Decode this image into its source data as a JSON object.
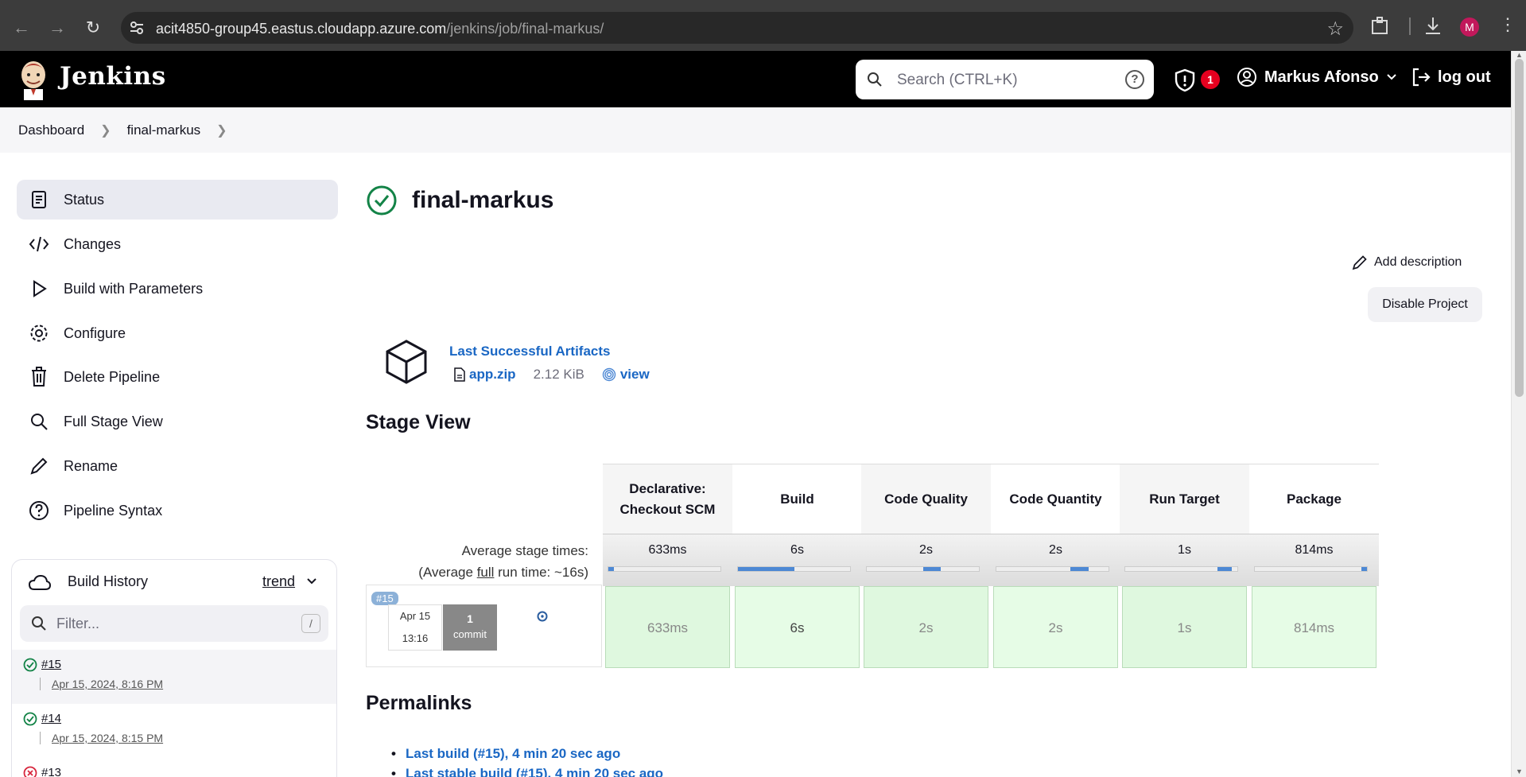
{
  "browser": {
    "url_host": "acit4850-group45.eastus.cloudapp.azure.com",
    "url_path": "/jenkins/job/final-markus/",
    "profile_initial": "M"
  },
  "header": {
    "brand": "Jenkins",
    "search_placeholder": "Search (CTRL+K)",
    "security_count": "1",
    "user_name": "Markus Afonso",
    "logout_label": "log out"
  },
  "breadcrumb": [
    "Dashboard",
    "final-markus"
  ],
  "sidebar": {
    "items": [
      {
        "label": "Status",
        "icon": "status-icon"
      },
      {
        "label": "Changes",
        "icon": "code-icon"
      },
      {
        "label": "Build with Parameters",
        "icon": "play-icon"
      },
      {
        "label": "Configure",
        "icon": "gear-icon"
      },
      {
        "label": "Delete Pipeline",
        "icon": "trash-icon"
      },
      {
        "label": "Full Stage View",
        "icon": "search-icon"
      },
      {
        "label": "Rename",
        "icon": "pencil-icon"
      },
      {
        "label": "Pipeline Syntax",
        "icon": "help-icon"
      }
    ]
  },
  "build_history": {
    "title": "Build History",
    "trend_label": "trend",
    "filter_placeholder": "Filter...",
    "filter_shortcut": "/",
    "builds": [
      {
        "number": "#15",
        "date": "Apr 15, 2024, 8:16 PM",
        "status": "success"
      },
      {
        "number": "#14",
        "date": "Apr 15, 2024, 8:15 PM",
        "status": "success"
      },
      {
        "number": "#13",
        "date": "",
        "status": "failed"
      }
    ]
  },
  "main": {
    "title": "final-markus",
    "add_description": "Add description",
    "disable_project": "Disable Project",
    "last_successful_artifacts": "Last Successful Artifacts",
    "artifact_name": "app.zip",
    "artifact_size": "2.12 KiB",
    "artifact_view": "view",
    "stage_view_title": "Stage View",
    "avg_stage_times_label": "Average stage times:",
    "avg_full_prefix": "(Average ",
    "avg_full_word": "full",
    "avg_full_suffix": " run time: ~16s)",
    "stages": [
      {
        "name": "Declarative: Checkout SCM",
        "avg": "633ms",
        "run": "633ms",
        "bar": [
          0.0,
          0.05
        ]
      },
      {
        "name": "Build",
        "avg": "6s",
        "run": "6s",
        "bar": [
          0.0,
          0.5
        ]
      },
      {
        "name": "Code Quality",
        "avg": "2s",
        "run": "2s",
        "bar": [
          0.5,
          0.66
        ]
      },
      {
        "name": "Code Quantity",
        "avg": "2s",
        "run": "2s",
        "bar": [
          0.66,
          0.82
        ]
      },
      {
        "name": "Run Target",
        "avg": "1s",
        "run": "1s",
        "bar": [
          0.82,
          0.95
        ]
      },
      {
        "name": "Package",
        "avg": "814ms",
        "run": "814ms",
        "bar": [
          0.95,
          1.0
        ]
      }
    ],
    "run": {
      "tag": "#15",
      "date": "Apr 15",
      "time": "13:16",
      "commit_count": "1",
      "commit_label": "commit"
    },
    "permalinks_title": "Permalinks",
    "permalinks": [
      "Last build (#15), 4 min 20 sec ago",
      "Last stable build (#15), 4 min 20 sec ago"
    ]
  }
}
